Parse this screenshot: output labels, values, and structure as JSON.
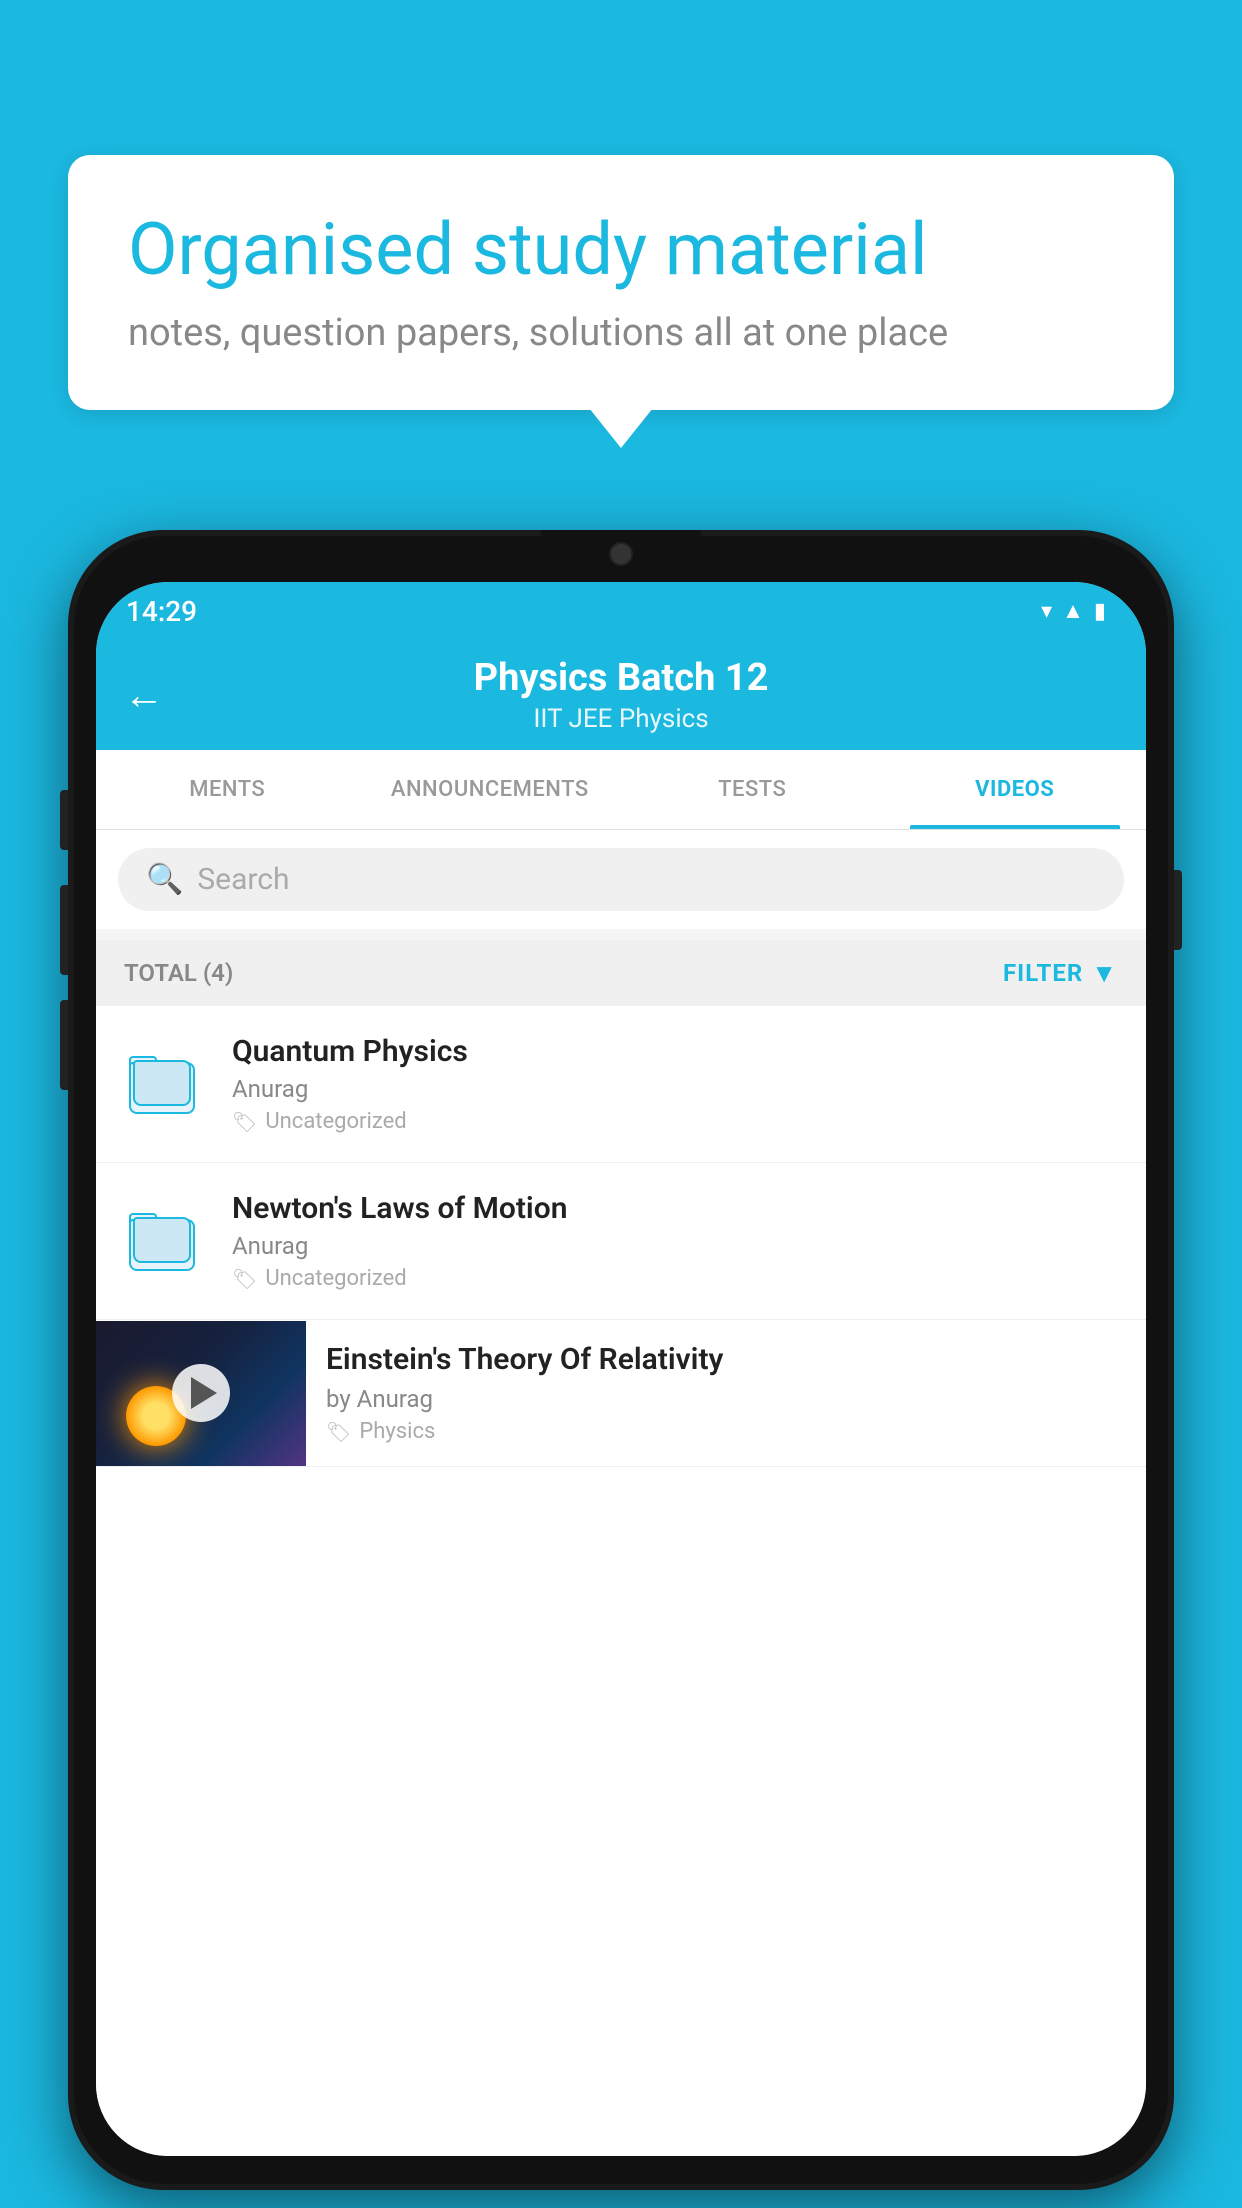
{
  "background_color": "#1BB8E0",
  "speech_card": {
    "title": "Organised study material",
    "subtitle": "notes, question papers, solutions all at one place"
  },
  "phone": {
    "status_bar": {
      "time": "14:29",
      "icons": [
        "wifi",
        "signal",
        "battery"
      ]
    },
    "app_bar": {
      "back_label": "←",
      "title": "Physics Batch 12",
      "subtitle": "IIT JEE   Physics"
    },
    "tabs": [
      {
        "label": "MENTS",
        "active": false
      },
      {
        "label": "ANNOUNCEMENTS",
        "active": false
      },
      {
        "label": "TESTS",
        "active": false
      },
      {
        "label": "VIDEOS",
        "active": true
      }
    ],
    "search": {
      "placeholder": "Search"
    },
    "filter_bar": {
      "total_label": "TOTAL (4)",
      "filter_label": "FILTER"
    },
    "list_items": [
      {
        "id": 1,
        "title": "Quantum Physics",
        "author": "Anurag",
        "tag": "Uncategorized",
        "type": "folder"
      },
      {
        "id": 2,
        "title": "Newton's Laws of Motion",
        "author": "Anurag",
        "tag": "Uncategorized",
        "type": "folder"
      },
      {
        "id": 3,
        "title": "Einstein's Theory Of Relativity",
        "author": "by Anurag",
        "tag": "Physics",
        "type": "video"
      }
    ]
  }
}
